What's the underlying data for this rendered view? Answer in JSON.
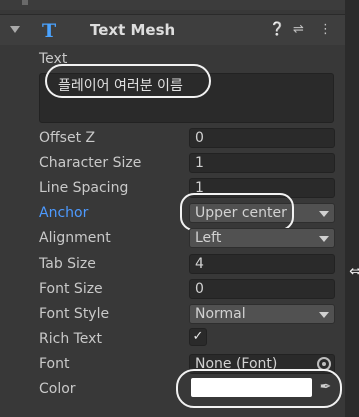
{
  "component": {
    "icon": "text-mesh-icon",
    "title": "Text Mesh",
    "header_icons": [
      "help-icon",
      "presets-icon",
      "more-icon"
    ]
  },
  "text": {
    "label": "Text",
    "value": "플레이어 여러분 이름"
  },
  "fields": {
    "offset_z": {
      "label": "Offset Z",
      "value": "0"
    },
    "character_size": {
      "label": "Character Size",
      "value": "1"
    },
    "line_spacing": {
      "label": "Line Spacing",
      "value": "1"
    },
    "anchor": {
      "label": "Anchor",
      "value": "Upper center"
    },
    "alignment": {
      "label": "Alignment",
      "value": "Left"
    },
    "tab_size": {
      "label": "Tab Size",
      "value": "4"
    },
    "font_size": {
      "label": "Font Size",
      "value": "0"
    },
    "font_style": {
      "label": "Font Style",
      "value": "Normal"
    },
    "rich_text": {
      "label": "Rich Text",
      "checked": true
    },
    "font": {
      "label": "Font",
      "value": "None (Font)"
    },
    "color": {
      "label": "Color",
      "value": "#ffffff"
    }
  },
  "colors": {
    "background": "#383838",
    "field": "#2a2a2a",
    "accent": "#4d9aff",
    "highlight_ring": "#f2f2f2"
  }
}
